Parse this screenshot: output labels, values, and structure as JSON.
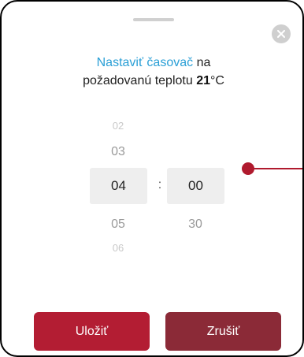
{
  "dialog": {
    "title_part1": "Nastaviť časovač",
    "title_part2": " na",
    "title_line2": "požadovanú teplotu ",
    "temperature": "21",
    "temperature_unit": "°C"
  },
  "picker": {
    "hours": {
      "above_far": "02",
      "above": "03",
      "selected": "04",
      "below": "05",
      "below_far": "06"
    },
    "separator": ":",
    "minutes": {
      "selected": "00",
      "below": "30"
    }
  },
  "buttons": {
    "save": "Uložiť",
    "cancel": "Zrušiť"
  },
  "colors": {
    "accent": "#2a9fd6",
    "primary": "#b31d33",
    "secondary": "#8b2a37"
  },
  "icons": {
    "close": "close-icon"
  }
}
